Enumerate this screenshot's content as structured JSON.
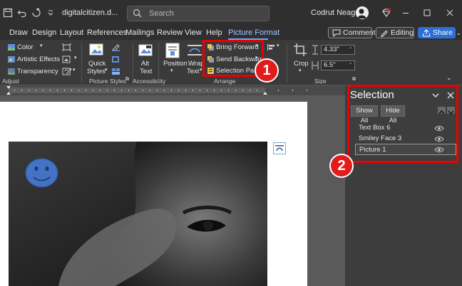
{
  "titlebar": {
    "document_title": "digitalcitizen.d...",
    "search_placeholder": "Search",
    "user_name": "Codrut Neagu",
    "window_controls": [
      "minimize",
      "restore",
      "close"
    ]
  },
  "tabs": [
    {
      "label": "Draw"
    },
    {
      "label": "Design"
    },
    {
      "label": "Layout"
    },
    {
      "label": "References"
    },
    {
      "label": "Mailings"
    },
    {
      "label": "Review"
    },
    {
      "label": "View"
    },
    {
      "label": "Help"
    },
    {
      "label": "Picture Format",
      "active": true
    }
  ],
  "header_buttons": {
    "comments": "Comments",
    "editing": "Editing",
    "share": "Share"
  },
  "ribbon": {
    "adjust": {
      "color": "Color",
      "artistic_effects": "Artistic Effects",
      "transparency": "Transparency",
      "group_label": "Adjust"
    },
    "picture_styles": {
      "quick_styles_line1": "Quick",
      "quick_styles_line2": "Styles",
      "group_label": "Picture Styles"
    },
    "accessibility": {
      "alt_text_line1": "Alt",
      "alt_text_line2": "Text",
      "group_label": "Accessibility"
    },
    "arrange": {
      "position": "Position",
      "wrap_text_line1": "Wrap",
      "wrap_text_line2": "Text",
      "bring_forward": "Bring Forward",
      "send_backward": "Send Backward",
      "selection_pane": "Selection Pane",
      "group_label": "Arrange"
    },
    "size": {
      "crop": "Crop",
      "height": "4.33\"",
      "width": "6.5\"",
      "group_label": "Size"
    }
  },
  "selection_pane": {
    "title": "Selection",
    "show_all": "Show All",
    "hide_all": "Hide All",
    "items": [
      {
        "label": "Text Box 6"
      },
      {
        "label": "Smiley Face 3"
      },
      {
        "label": "Picture 1",
        "selected": true
      }
    ]
  },
  "callouts": {
    "one": "1",
    "two": "2"
  },
  "colors": {
    "accent": "#6aa9ff",
    "share": "#2d6fd6",
    "callout": "#e31b1b",
    "smiley_fill": "#4472c4"
  }
}
